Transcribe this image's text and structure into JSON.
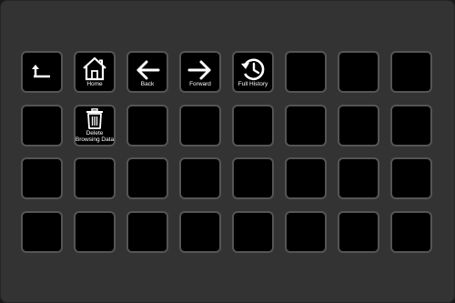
{
  "keys": {
    "up_folder": {
      "label": ""
    },
    "home": {
      "label": "Home"
    },
    "back": {
      "label": "Back"
    },
    "forward": {
      "label": "Forward"
    },
    "full_history": {
      "label": "Full History"
    },
    "delete_browsing_data": {
      "label": "Delete\nBrowsing Data"
    }
  },
  "colors": {
    "device": "#333333",
    "key_face": "#000000",
    "key_border": "#555555",
    "icon": "#ffffff"
  }
}
